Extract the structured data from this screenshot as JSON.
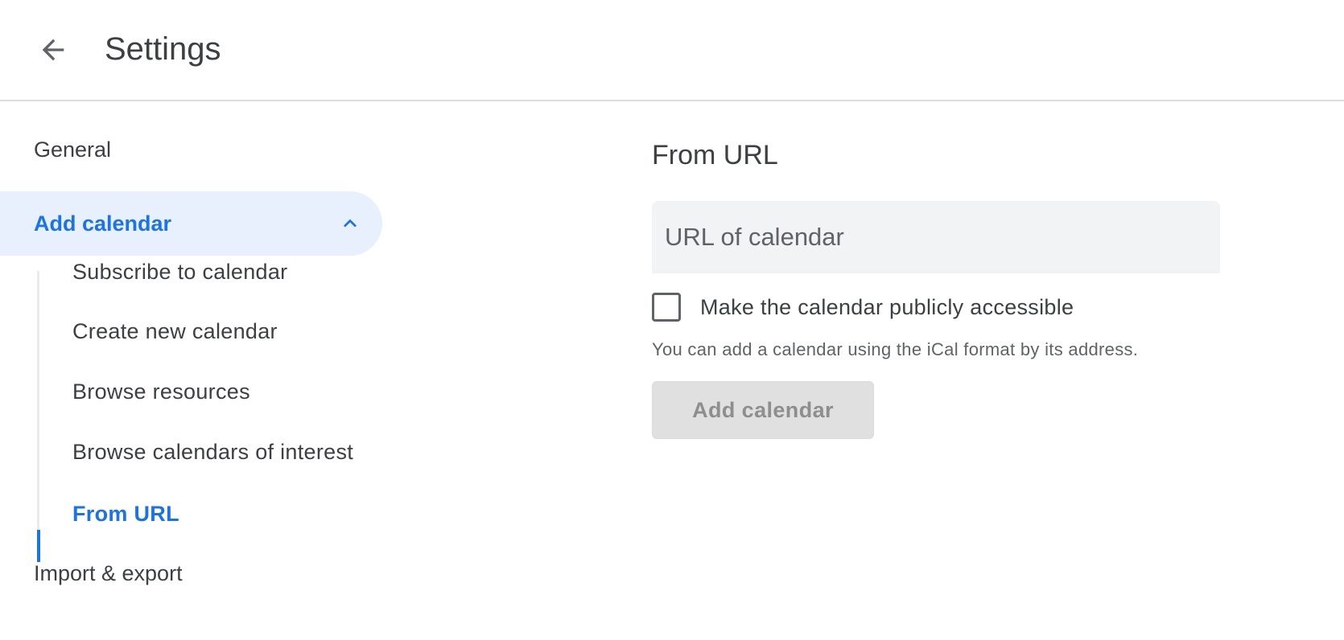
{
  "header": {
    "back_icon": "arrow-back-icon",
    "title": "Settings"
  },
  "sidebar": {
    "general": "General",
    "add_calendar": {
      "label": "Add calendar",
      "icon": "chevron-up-icon",
      "expanded": true,
      "items": [
        {
          "label": "Subscribe to calendar"
        },
        {
          "label": "Create new calendar"
        },
        {
          "label": "Browse resources"
        },
        {
          "label": "Browse calendars of interest"
        },
        {
          "label": "From URL",
          "active": true
        }
      ]
    },
    "import_export": "Import & export"
  },
  "main": {
    "section_title": "From URL",
    "url_field": {
      "placeholder": "URL of calendar",
      "value": ""
    },
    "public_checkbox": {
      "label": "Make the calendar publicly accessible",
      "checked": false
    },
    "helper_text": "You can add a calendar using the iCal format by its address.",
    "add_button": {
      "label": "Add calendar",
      "disabled": true
    }
  },
  "colors": {
    "accent": "#1a73e8",
    "active_bg": "#e8f0fe",
    "text": "#3c4043",
    "field_bg": "#f1f3f4",
    "disabled_button_bg": "#e0e0e0"
  }
}
